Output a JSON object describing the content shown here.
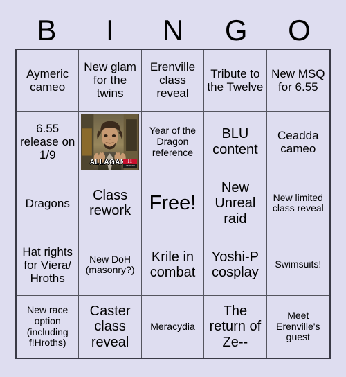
{
  "header": {
    "letters": [
      "B",
      "I",
      "N",
      "G",
      "O"
    ]
  },
  "card": {
    "background_color": "#deddf0",
    "border_color": "#3a3a46",
    "grid_line_color": "#55555f",
    "text_color": "#000000"
  },
  "cells": [
    {
      "text": "Aymeric cameo",
      "size": "fs-md",
      "type": "text"
    },
    {
      "text": "New glam for the twins",
      "size": "fs-md",
      "type": "text"
    },
    {
      "text": "Erenville class reveal",
      "size": "fs-md",
      "type": "text"
    },
    {
      "text": "Tribute to the Twelve",
      "size": "fs-md",
      "type": "text"
    },
    {
      "text": "New MSQ for 6.55",
      "size": "fs-md",
      "type": "text"
    },
    {
      "text": "6.55 release on 1/9",
      "size": "fs-md",
      "type": "text"
    },
    {
      "text": "",
      "size": "fs-md",
      "type": "image",
      "image": {
        "name": "ancient-aliens-meme",
        "caption": "ALLAGANS",
        "logo_letter": "H",
        "logo_word": "HISTORY"
      }
    },
    {
      "text": "Year of the Dragon reference",
      "size": "fs-sm",
      "type": "text"
    },
    {
      "text": "BLU content",
      "size": "fs-lg",
      "type": "text"
    },
    {
      "text": "Ceadda cameo",
      "size": "fs-md",
      "type": "text"
    },
    {
      "text": "Dragons",
      "size": "fs-md",
      "type": "text"
    },
    {
      "text": "Class rework",
      "size": "fs-lg",
      "type": "text"
    },
    {
      "text": "Free!",
      "size": "fs-xl",
      "type": "text"
    },
    {
      "text": "New Unreal raid",
      "size": "fs-lg",
      "type": "text"
    },
    {
      "text": "New limited class reveal",
      "size": "fs-sm",
      "type": "text"
    },
    {
      "text": "Hat rights for Viera/ Hroths",
      "size": "fs-md",
      "type": "text"
    },
    {
      "text": "New DoH (masonry?)",
      "size": "fs-sm",
      "type": "text"
    },
    {
      "text": "Krile in combat",
      "size": "fs-lg",
      "type": "text"
    },
    {
      "text": "Yoshi-P cosplay",
      "size": "fs-lg",
      "type": "text"
    },
    {
      "text": "Swimsuits!",
      "size": "fs-sm",
      "type": "text"
    },
    {
      "text": "New race option (including f!Hroths)",
      "size": "fs-sm",
      "type": "text"
    },
    {
      "text": "Caster class reveal",
      "size": "fs-lg",
      "type": "text"
    },
    {
      "text": "Meracydia",
      "size": "fs-sm",
      "type": "text"
    },
    {
      "text": "The return of Ze--",
      "size": "fs-lg",
      "type": "text"
    },
    {
      "text": "Meet Erenville's guest",
      "size": "fs-sm",
      "type": "text"
    }
  ]
}
